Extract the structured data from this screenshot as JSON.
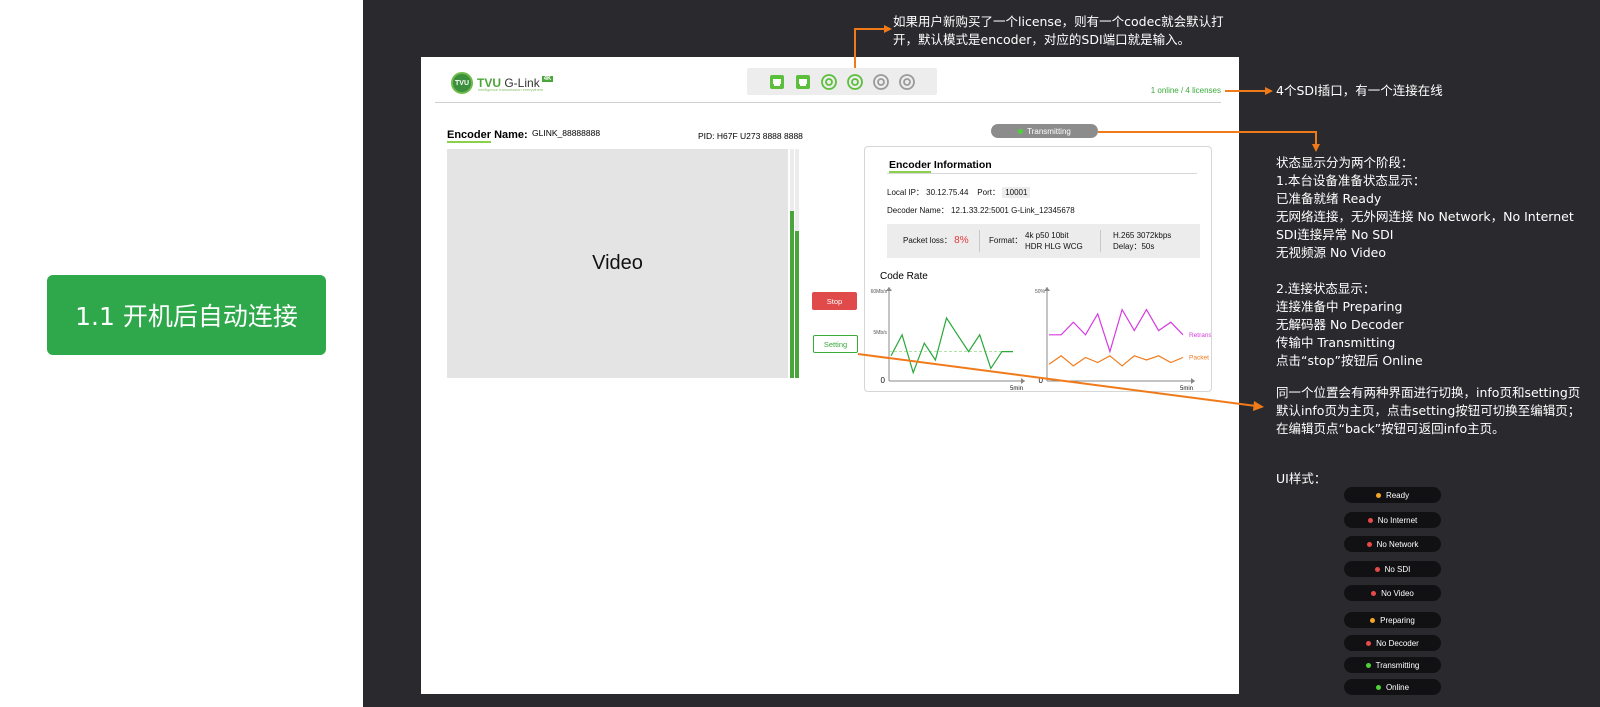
{
  "section": {
    "title": "1.1 开机后自动连接"
  },
  "annotations": {
    "top_note": [
      "如果用户新购买了一个license，则有一个codec就会默认打",
      "开，默认模式是encoder，对应的SDI端口就是输入。"
    ],
    "sdi_note": "4个SDI插口，有一个连接在线",
    "status_note": [
      "状态显示分为两个阶段：",
      "1.本台设备准备状态显示：",
      "已准备就绪  Ready",
      "无网络连接，无外网连接  No Network，No Internet",
      "SDI连接异常  No SDI",
      "无视频源  No Video",
      "",
      "2.连接状态显示：",
      "连接准备中  Preparing",
      "无解码器  No Decoder",
      "传输中  Transmitting",
      "点击“stop”按钮后  Online"
    ],
    "switch_note": [
      "同一个位置会有两种界面进行切换，info页和setting页",
      "默认info页为主页，点击setting按钮可切换至编辑页；",
      "在编辑页点“back”按钮可返回info主页。"
    ],
    "ui_style_label": "UI样式："
  },
  "app": {
    "logo": {
      "badge": "TVU",
      "name_green": "TVU",
      "name_rest": "G-Link",
      "tag": "4K",
      "slogan": "intelligence transmission everywhere"
    },
    "ports": [
      "sdi-port-icon",
      "sdi-port-icon",
      "ring-active-icon",
      "ring-active-icon",
      "ring-idle-icon",
      "ring-idle-icon"
    ],
    "license_text": "1 online / 4 licenses",
    "encoder": {
      "label_u": "Encoder",
      "label_rest": " Name:",
      "value": "GLINK_88888888"
    },
    "pid": "PID: H67F U273 8888 8888",
    "video_label": "Video",
    "meters": [
      0.73,
      0.64
    ],
    "stop_label": "Stop",
    "setting_label": "Setting",
    "status": {
      "label": "Transmitting",
      "color": "#4cd437"
    },
    "info": {
      "title_u": "Encoder",
      "title_rest": " Information",
      "local_ip_label": "Local  IP：",
      "local_ip": "30.12.75.44",
      "port_label": "Port：",
      "port": "10001",
      "decoder_label": "Decoder Name：",
      "decoder": "12.1.33.22:5001 G-Link_12345678",
      "packet_loss_label": "Packet loss：",
      "packet_loss": "8%",
      "format_label": "Format：",
      "format_line1": "4k p50 10bit",
      "format_line2": "HDR HLG WCG",
      "codec_line1": "H.265 3072kbps",
      "codec_line2": "Delay：50s",
      "code_rate_title": "Code Rate"
    }
  },
  "chart_data": [
    {
      "type": "line",
      "title": "",
      "ylim_labels": [
        "60Mb/s",
        "5Mb/s",
        "0"
      ],
      "xlabel": "5min",
      "series": [
        {
          "values": [
            0.3,
            0.55,
            0.1,
            0.45,
            0.25,
            0.75,
            0.55,
            0.35,
            0.55,
            0.15,
            0.35,
            0.35
          ]
        }
      ],
      "reference_line": 0.35,
      "color": "#2aa83a"
    },
    {
      "type": "line",
      "title": "",
      "ylim_labels": [
        "50%",
        "0"
      ],
      "xlabel": "5min",
      "series": [
        {
          "name": "Retransmission Rate",
          "color": "#d63be0",
          "values": [
            0.55,
            0.55,
            0.7,
            0.55,
            0.8,
            0.35,
            0.85,
            0.6,
            0.85,
            0.6,
            0.7,
            0.55
          ]
        },
        {
          "name": "Packet Loss Rate",
          "color": "#f07a1a",
          "values": [
            0.2,
            0.3,
            0.18,
            0.28,
            0.22,
            0.3,
            0.18,
            0.3,
            0.25,
            0.3,
            0.22,
            0.28
          ]
        }
      ]
    }
  ],
  "legend_pills": [
    {
      "label": "Ready",
      "color": "#f5a623"
    },
    {
      "label": "No Internet",
      "color": "#e84a4a"
    },
    {
      "label": "No Network",
      "color": "#e84a4a"
    },
    {
      "label": "No SDI",
      "color": "#e84a4a"
    },
    {
      "label": "No Video",
      "color": "#e84a4a"
    },
    {
      "label": "Preparing",
      "color": "#f5a623"
    },
    {
      "label": "No Decoder",
      "color": "#e84a4a"
    },
    {
      "label": "Transmitting",
      "color": "#4cd437"
    },
    {
      "label": "Online",
      "color": "#4cd437"
    }
  ],
  "colors": {
    "accent_green": "#2ea84a",
    "dark_bg": "#2a2a2e",
    "arrow": "#f07a1a"
  }
}
